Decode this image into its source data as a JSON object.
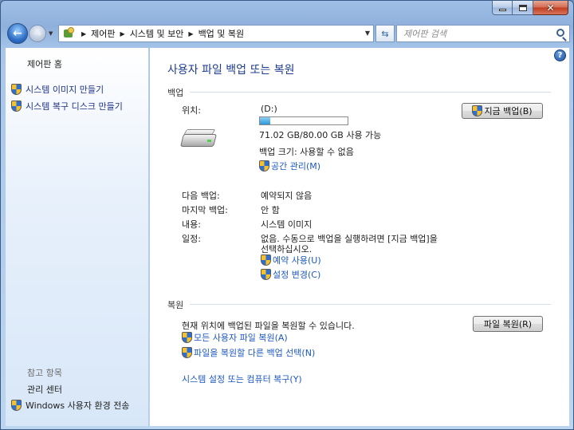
{
  "window": {
    "controls": {
      "minimize": "–",
      "maximize": "□",
      "close": "✕"
    }
  },
  "nav": {
    "breadcrumb": [
      "제어판",
      "시스템 및 보안",
      "백업 및 복원"
    ],
    "search_placeholder": "제어판 검색"
  },
  "sidebar": {
    "home": "제어판 홈",
    "tasks": [
      "시스템 이미지 만들기",
      "시스템 복구 디스크 만들기"
    ],
    "see_also_caption": "참고 항목",
    "see_also": [
      "관리 센터",
      "Windows 사용자 환경 전송"
    ]
  },
  "main": {
    "title": "사용자 파일 백업 또는 복원",
    "backup": {
      "heading": "백업",
      "location_label": "위치:",
      "location_value": "(D:)",
      "disk_used_fraction": 0.12,
      "free_space": "71.02 GB/80.00 GB 사용 가능",
      "backup_size": "백업 크기: 사용할 수 없음",
      "manage_space": "공간 관리(M)",
      "backup_now_button": "지금 백업(B)",
      "next_label": "다음 백업:",
      "next_value": "예약되지 않음",
      "last_label": "마지막 백업:",
      "last_value": "안 함",
      "contents_label": "내용:",
      "contents_value": "시스템 이미지",
      "schedule_label": "일정:",
      "schedule_line1": "없음. 수동으로 백업을 실행하려면 [지금 백업]을",
      "schedule_line2": "선택하십시오.",
      "turn_on_schedule": "예약 사용(U)",
      "change_settings": "설정 변경(C)"
    },
    "restore": {
      "heading": "복원",
      "description": "현재 위치에 백업된 파일을 복원할 수 있습니다.",
      "restore_files_button": "파일 복원(R)",
      "restore_all_users": "모든 사용자 파일 복원(A)",
      "select_other_backup": "파일을 복원할 다른 백업 선택(N)",
      "recover_system": "시스템 설정 또는 컴퓨터 복구(Y)"
    },
    "help": "?"
  }
}
